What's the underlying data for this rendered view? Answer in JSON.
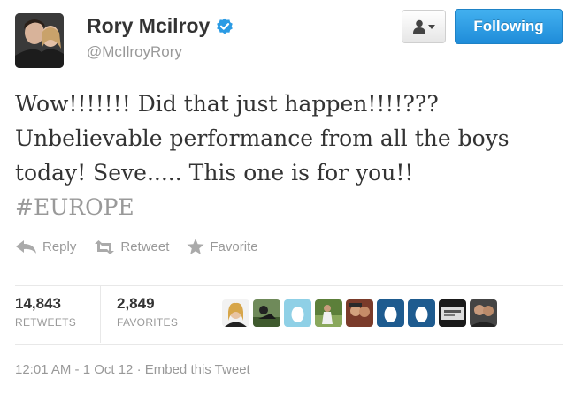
{
  "header": {
    "name": "Rory Mcilroy",
    "handle": "@McIlroyRory",
    "follow_label": "Following",
    "accent_color": "#2b9be4"
  },
  "tweet": {
    "text": "Wow!!!!!!! Did that just happen!!!!??? Unbelievable performance from all the boys today! Seve..... This one is for you!!",
    "hashtag": "#EUROPE"
  },
  "actions": {
    "reply": "Reply",
    "retweet": "Retweet",
    "favorite": "Favorite"
  },
  "stats": {
    "retweets_count": "14,843",
    "retweets_label": "RETWEETS",
    "favorites_count": "2,849",
    "favorites_label": "FAVORITES"
  },
  "footer": {
    "time": "12:01 AM - 1 Oct 12",
    "separator": "·",
    "embed": "Embed this Tweet"
  }
}
